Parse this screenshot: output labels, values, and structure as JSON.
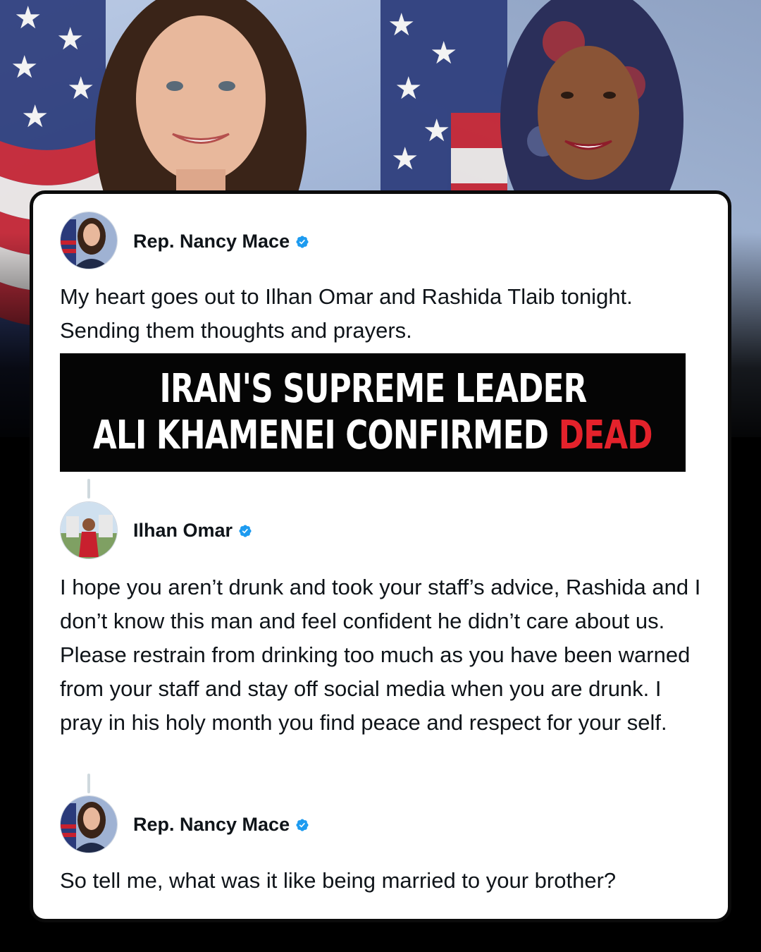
{
  "colors": {
    "verified_blue": "#1d9bf0",
    "headline_red": "#e4222b",
    "card_background": "#ffffff",
    "page_background": "#000000"
  },
  "posts": [
    {
      "author": "Rep. Nancy Mace",
      "verified_icon": "verified-badge-icon",
      "text": "My heart goes out to Ilhan Omar and Rashida Tlaib tonight. Sending them thoughts and prayers."
    },
    {
      "author": "Ilhan Omar",
      "verified_icon": "verified-badge-icon",
      "text": "I hope you aren’t drunk and took your staff’s advice, Rashida and I don’t know this man and feel confident he didn’t care about us. Please restrain from drinking too much as you have been warned from your staff and stay off social media when you are drunk. I pray in his holy month you find peace and respect for your self."
    },
    {
      "author": "Rep. Nancy Mace",
      "verified_icon": "verified-badge-icon",
      "text": "So tell me, what was it like being married to your brother?"
    }
  ],
  "headline": {
    "line1": "IRAN'S SUPREME LEADER",
    "line2_white": "ALI KHAMENEI CONFIRMED",
    "line2_red": "DEAD"
  }
}
